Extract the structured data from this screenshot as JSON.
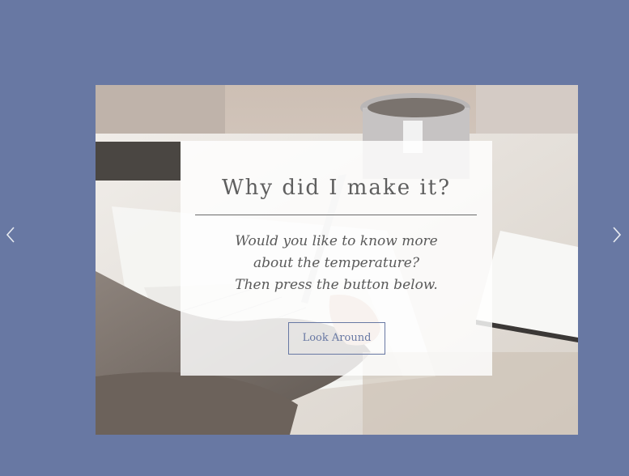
{
  "slider": {
    "prev_icon": "chevron-left-icon",
    "next_icon": "chevron-right-icon"
  },
  "card": {
    "title": "Why did I make it?",
    "text_lines": [
      "Would you like to know more",
      "about the temperature?",
      "Then press the button below."
    ],
    "button_label": "Look Around"
  },
  "colors": {
    "background": "#6878a3",
    "accent": "#6878a3",
    "card_overlay": "rgba(255,255,255,0.82)",
    "title_text": "#5f5f5f"
  }
}
